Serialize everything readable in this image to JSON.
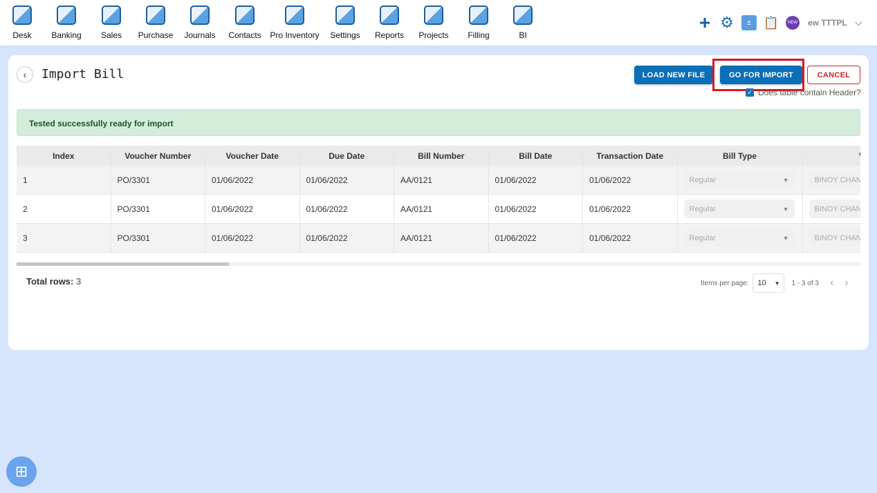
{
  "nav": [
    {
      "label": "Desk",
      "icon": "desk-icon"
    },
    {
      "label": "Banking",
      "icon": "bank-icon"
    },
    {
      "label": "Sales",
      "icon": "sales-icon"
    },
    {
      "label": "Purchase",
      "icon": "purchase-icon"
    },
    {
      "label": "Journals",
      "icon": "journals-icon"
    },
    {
      "label": "Contacts",
      "icon": "contacts-icon"
    },
    {
      "label": "Pro Inventory",
      "icon": "inventory-icon"
    },
    {
      "label": "Settings",
      "icon": "settings-icon"
    },
    {
      "label": "Reports",
      "icon": "reports-icon"
    },
    {
      "label": "Projects",
      "icon": "projects-icon"
    },
    {
      "label": "Filling",
      "icon": "filling-icon"
    },
    {
      "label": "BI",
      "icon": "bi-icon"
    }
  ],
  "header": {
    "company": "ew TTTPL",
    "new_badge": "NEW"
  },
  "page": {
    "title": "Import Bill",
    "load_new_file": "LOAD NEW FILE",
    "go_for_import": "GO FOR IMPORT",
    "cancel": "CANCEL",
    "header_checkbox_label": "Does table contain Header?",
    "header_checked": true,
    "alert": "Tested successfully ready for import"
  },
  "table": {
    "columns": [
      "Index",
      "Voucher Number",
      "Voucher Date",
      "Due Date",
      "Bill Number",
      "Bill Date",
      "Transaction Date",
      "Bill Type",
      "Vendo"
    ],
    "rows": [
      [
        "1",
        "PO/3301",
        "01/06/2022",
        "01/06/2022",
        "AA/0121",
        "01/06/2022",
        "01/06/2022",
        "Regular",
        "BINOY CHAN"
      ],
      [
        "2",
        "PO/3301",
        "01/06/2022",
        "01/06/2022",
        "AA/0121",
        "01/06/2022",
        "01/06/2022",
        "Regular",
        "BINOY CHAN"
      ],
      [
        "3",
        "PO/3301",
        "01/06/2022",
        "01/06/2022",
        "AA/0121",
        "01/06/2022",
        "01/06/2022",
        "Regular",
        "BINOY CHAN"
      ]
    ]
  },
  "footer": {
    "total_label": "Total rows:",
    "total_value": "3",
    "items_per_page_label": "Items per page:",
    "items_per_page": "10",
    "range": "1 - 3 of 3"
  },
  "colors": {
    "primary": "#0a6fb8",
    "cancel": "#c62828",
    "highlight": "#e0141e",
    "success_bg": "#d4edda"
  }
}
